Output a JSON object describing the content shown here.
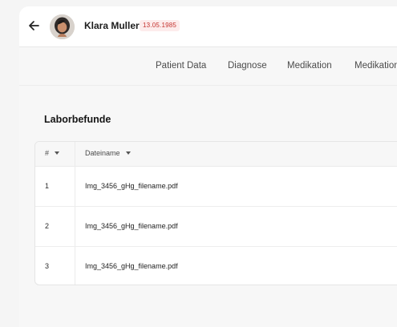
{
  "patient": {
    "name": "Klara Muller",
    "birth_date": "13.05.1985"
  },
  "tabs": [
    {
      "label": "Patient Data"
    },
    {
      "label": "Diagnose"
    },
    {
      "label": "Medikation"
    },
    {
      "label": "Medikation"
    }
  ],
  "section": {
    "title": "Laborbefunde"
  },
  "table": {
    "columns": [
      {
        "label": "#"
      },
      {
        "label": "Dateiname"
      }
    ],
    "rows": [
      {
        "index": "1",
        "filename": "Img_3456_gHg_filename.pdf"
      },
      {
        "index": "2",
        "filename": "Img_3456_gHg_filename.pdf"
      },
      {
        "index": "3",
        "filename": "Img_3456_gHg_filename.pdf"
      }
    ]
  },
  "colors": {
    "badge_text": "#c4322e",
    "badge_background": "#fdecec",
    "surface": "#ffffff",
    "background": "#f7f7f7"
  },
  "icons": {
    "back": "arrow-left-icon",
    "sort": "caret-down-icon"
  }
}
